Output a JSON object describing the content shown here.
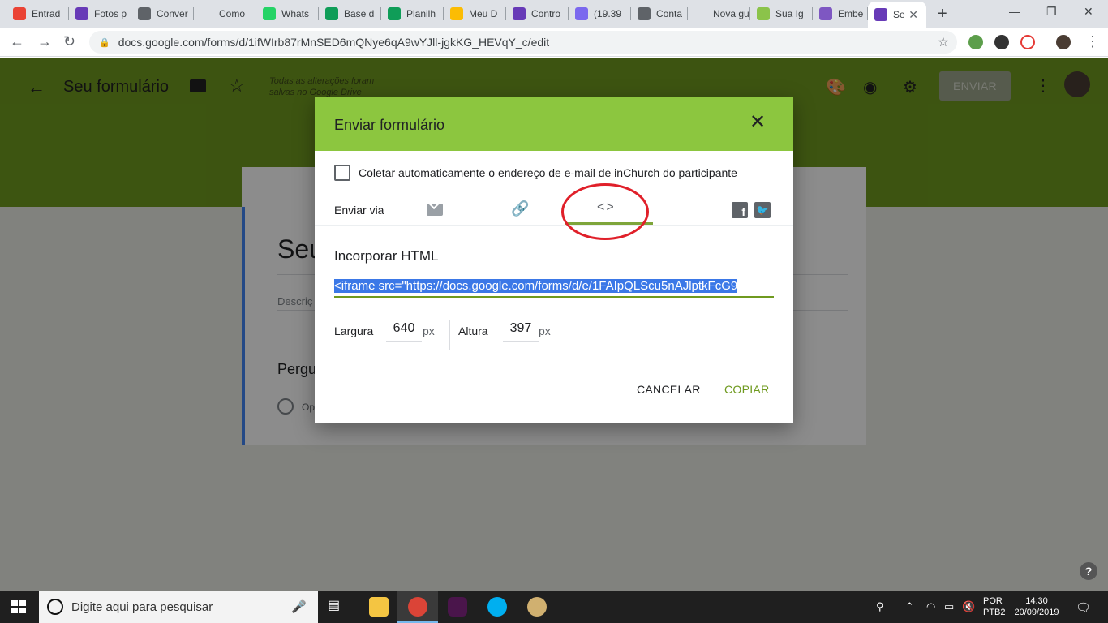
{
  "browser": {
    "tabs": [
      {
        "label": "Entrad",
        "icon": "gmail-icon",
        "color": "#ea4335"
      },
      {
        "label": "Fotos p",
        "icon": "forms-icon",
        "color": "#673ab7"
      },
      {
        "label": "Conver",
        "icon": "zapier-icon",
        "color": "#5f6368"
      },
      {
        "label": "Como",
        "icon": "blank-icon",
        "color": "#dee1e6"
      },
      {
        "label": "Whats",
        "icon": "whatsapp-icon",
        "color": "#25d366"
      },
      {
        "label": "Base d",
        "icon": "sheets-icon",
        "color": "#0f9d58"
      },
      {
        "label": "Planilh",
        "icon": "sheets-icon",
        "color": "#0f9d58"
      },
      {
        "label": "Meu D",
        "icon": "drive-icon",
        "color": "#fbbc04"
      },
      {
        "label": "Contro",
        "icon": "forms-icon",
        "color": "#673ab7"
      },
      {
        "label": "(19.39",
        "icon": "mail-icon",
        "color": "#7b68ee"
      },
      {
        "label": "Conta",
        "icon": "zapier-icon",
        "color": "#5f6368"
      },
      {
        "label": "Nova guia",
        "icon": "blank-icon",
        "color": "#dee1e6"
      },
      {
        "label": "Sua Ig",
        "icon": "grid-icon",
        "color": "#8bc34a"
      },
      {
        "label": "Embe",
        "icon": "s-icon",
        "color": "#7e57c2"
      },
      {
        "label": "Se",
        "icon": "forms-icon",
        "color": "#673ab7"
      }
    ],
    "url": "docs.google.com/forms/d/1ifWIrb87rMnSED6mQNye6qA9wYJll-jgkKG_HEVqY_c/edit"
  },
  "forms_header": {
    "title": "Seu formulário",
    "saved_status": "Todas as alterações foram salvas no Google Drive",
    "send_label": "ENVIAR"
  },
  "form_preview": {
    "title": "Seu",
    "description": "Descriç",
    "question": "Pergu",
    "option": "Opç"
  },
  "dialog": {
    "title": "Enviar formulário",
    "collect_email_label": "Coletar automaticamente o endereço de e-mail de inChurch do participante",
    "send_via_label": "Enviar via",
    "embed_title": "Incorporar HTML",
    "embed_code": "<iframe src=\"https://docs.google.com/forms/d/e/1FAIpQLScu5nAJlptkFcG9",
    "width_label": "Largura",
    "width_value": "640",
    "height_label": "Altura",
    "height_value": "397",
    "unit": "px",
    "cancel_label": "CANCELAR",
    "copy_label": "COPIAR"
  },
  "taskbar": {
    "search_placeholder": "Digite aqui para pesquisar",
    "lang_line1": "POR",
    "lang_line2": "PTB2",
    "time": "14:30",
    "date": "20/09/2019"
  },
  "colors": {
    "header_green": "#6f9a1f",
    "dialog_header": "#8cc63f",
    "accent": "#6f9a1f",
    "selection": "#3b78e7",
    "annotation_red": "#e0202a"
  }
}
